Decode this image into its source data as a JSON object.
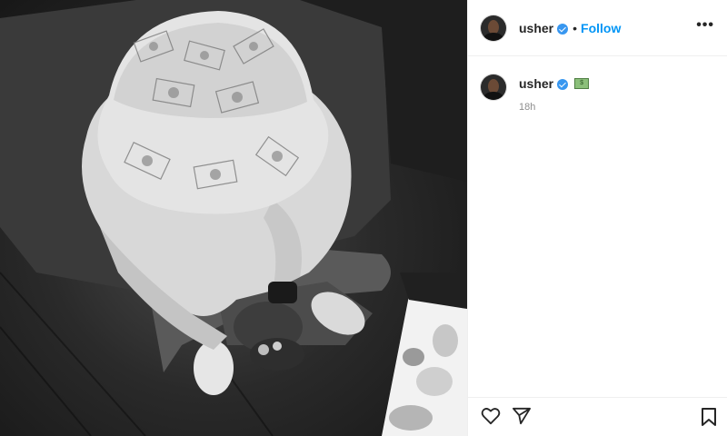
{
  "post": {
    "username": "usher",
    "verified": true,
    "separator": "•",
    "follow_label": "Follow",
    "more_label": "•••",
    "caption_emoji": "money-emoji",
    "timestamp": "18h"
  },
  "icons": {
    "more": "more-options-icon",
    "like": "heart-icon",
    "share": "paper-plane-icon",
    "save": "bookmark-icon"
  },
  "colors": {
    "accent": "#0095f6",
    "verified": "#3897f0",
    "text": "#262626",
    "muted": "#8e8e8e"
  }
}
